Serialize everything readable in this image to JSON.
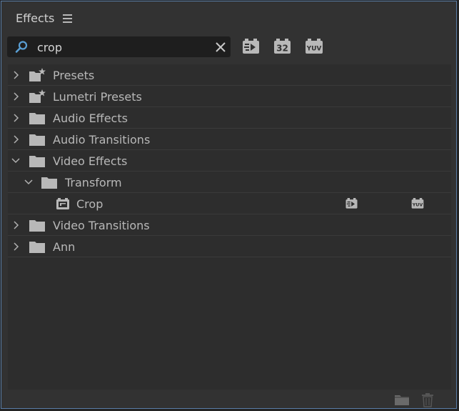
{
  "panel": {
    "title": "Effects",
    "menu_icon": "hamburger-menu-icon"
  },
  "search": {
    "value": "crop",
    "placeholder": "",
    "icon": "search-icon",
    "clear_icon": "close-icon"
  },
  "toolbar": {
    "buttons": [
      {
        "name": "accelerated-effects",
        "icon": "accelerated-effects-icon",
        "text": ""
      },
      {
        "name": "32-bit-color",
        "icon": "32-bit-icon",
        "text": "32"
      },
      {
        "name": "yuv-effects",
        "icon": "yuv-icon",
        "text": "YUV"
      }
    ]
  },
  "tree": {
    "items": [
      {
        "label": "Presets",
        "icon": "preset-folder-icon",
        "expanded": false,
        "level": 0
      },
      {
        "label": "Lumetri Presets",
        "icon": "preset-folder-icon",
        "expanded": false,
        "level": 0
      },
      {
        "label": "Audio Effects",
        "icon": "folder-icon",
        "expanded": false,
        "level": 0
      },
      {
        "label": "Audio Transitions",
        "icon": "folder-icon",
        "expanded": false,
        "level": 0
      },
      {
        "label": "Video Effects",
        "icon": "folder-icon",
        "expanded": true,
        "level": 0
      },
      {
        "label": "Transform",
        "icon": "folder-icon",
        "expanded": true,
        "level": 1
      },
      {
        "label": "Crop",
        "icon": "effect-icon",
        "level": 2,
        "badges": [
          "accelerated-effects-icon",
          "yuv-icon"
        ]
      },
      {
        "label": "Video Transitions",
        "icon": "folder-icon",
        "expanded": false,
        "level": 0
      },
      {
        "label": "Ann",
        "icon": "folder-icon",
        "expanded": false,
        "level": 0
      }
    ]
  },
  "footer": {
    "buttons": [
      {
        "icon": "new-bin-icon"
      },
      {
        "icon": "trash-icon"
      }
    ]
  },
  "colors": {
    "panel_bg": "#323232",
    "tree_bg": "#2d2d2d",
    "search_bg": "#1e1e1e",
    "text": "#b8b8b8",
    "accent": "#5a9fd4"
  }
}
